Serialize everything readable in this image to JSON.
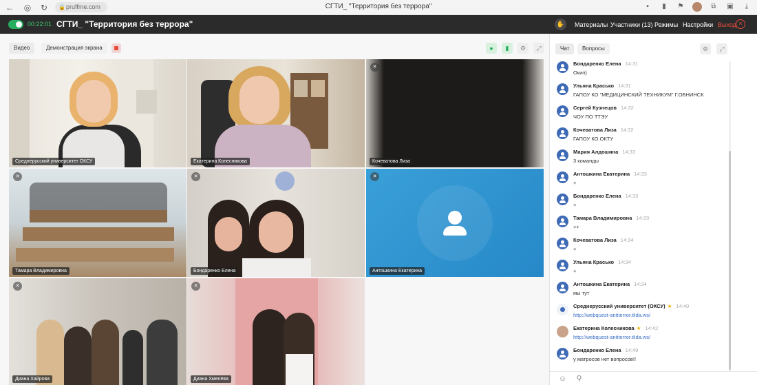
{
  "browser": {
    "url": "pruffme.com",
    "tab_title": "СГТИ_ \"Территория без террора\""
  },
  "header": {
    "timer": "00:22:01",
    "title": "СГТИ_ \"Территория без террора\"",
    "materials": "Материалы",
    "participants": "Участники (13)",
    "modes": "Режимы",
    "settings": "Настройки",
    "exit": "Выход"
  },
  "toolbar": {
    "video": "Видео",
    "screen_demo": "Демонстрация экрана"
  },
  "tiles": [
    {
      "name": "Среднерусский университет ОКСУ",
      "mic_muted": false,
      "kind": "video"
    },
    {
      "name": "Екатерина Колесникова",
      "mic_muted": false,
      "kind": "video"
    },
    {
      "name": "Кочеватова Лиза",
      "mic_muted": true,
      "kind": "dark"
    },
    {
      "name": "Тамара Владимировна",
      "mic_muted": true,
      "kind": "video"
    },
    {
      "name": "Бондаренко Елена",
      "mic_muted": true,
      "kind": "video"
    },
    {
      "name": "Антошкина Екатерина",
      "mic_muted": true,
      "kind": "avatar"
    },
    {
      "name": "Диана Хайрова",
      "mic_muted": true,
      "kind": "video"
    },
    {
      "name": "Диана Хмелёва",
      "mic_muted": true,
      "kind": "video"
    }
  ],
  "chat": {
    "tab_chat": "Чат",
    "tab_questions": "Вопросы",
    "messages": [
      {
        "author": "Бондаренко Елена",
        "time": "14:31",
        "text": "Окип)"
      },
      {
        "author": "Ульяна Красько",
        "time": "14:31",
        "text": "ГАПОУ КО \"МЕДИЦИНСКИЙ ТЕХНИКУМ\" Г.ОБНИНСК"
      },
      {
        "author": "Сергей Кузнецов",
        "time": "14:32",
        "text": "ЧОУ ПО ТТЭУ"
      },
      {
        "author": "Кочеватова Лиза",
        "time": "14:32",
        "text": "ГАПОУ КО ОКТУ"
      },
      {
        "author": "Мария Алдошина",
        "time": "14:33",
        "text": "3 команды"
      },
      {
        "author": "Антошкина Екатерина",
        "time": "14:33",
        "text": "+"
      },
      {
        "author": "Бондаренко Елена",
        "time": "14:33",
        "text": "+"
      },
      {
        "author": "Тамара Владимировна",
        "time": "14:33",
        "text": "++"
      },
      {
        "author": "Кочеватова Лиза",
        "time": "14:34",
        "text": "+"
      },
      {
        "author": "Ульяна Красько",
        "time": "14:34",
        "text": "+"
      },
      {
        "author": "Антошкина Екатерина",
        "time": "14:34",
        "text": "мы тут"
      },
      {
        "author": "Среднерусский университет (ОКСУ)",
        "time": "14:40",
        "text": "http://webquest-antiterror.tilda.ws/",
        "star": "★",
        "avatar": "logo",
        "link": true
      },
      {
        "author": "Екатерина Колесникова",
        "time": "14:42",
        "text": "http://webquest-antiterror.tilda.ws/",
        "star": "★",
        "avatar": "photo",
        "link": true
      },
      {
        "author": "Бондаренко Елена",
        "time": "14:49",
        "text": "у матросов нет вопросов!!"
      }
    ]
  },
  "colors": {
    "accent_green": "#27ae60",
    "exit_red": "#e84c3d",
    "avatar_blue": "#3f6ab5",
    "link_blue": "#3b6fc7",
    "avatar_tile_bg": "#2d8fd2"
  }
}
